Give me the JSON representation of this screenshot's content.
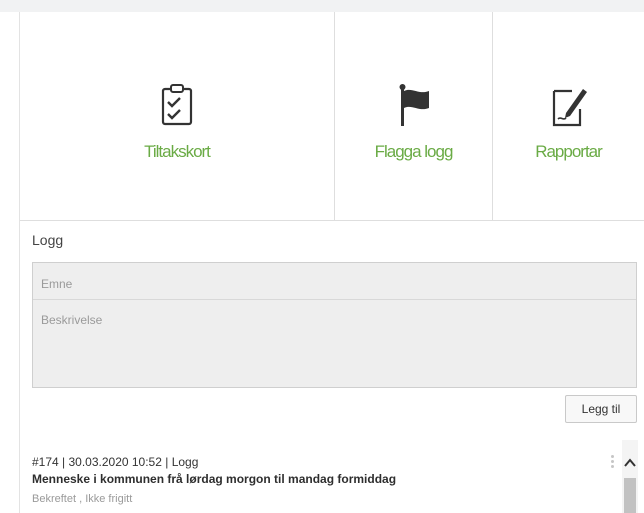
{
  "tiles": [
    {
      "label": "Tiltakskort",
      "icon": "clipboard-check-icon"
    },
    {
      "label": "Flagga logg",
      "icon": "flag-icon"
    },
    {
      "label": "Rapportar",
      "icon": "edit-document-icon"
    }
  ],
  "log_section": {
    "title": "Logg",
    "subject_placeholder": "Emne",
    "description_placeholder": "Beskrivelse",
    "add_button": "Legg til"
  },
  "entries": [
    {
      "meta": "#174 | 30.03.2020 10:52 | Logg",
      "title": "Menneske i kommunen frå lørdag morgon til mandag formiddag",
      "status": "Bekreftet , Ikke frigitt"
    }
  ],
  "colors": {
    "accent": "#6aab45",
    "icon": "#333333"
  }
}
